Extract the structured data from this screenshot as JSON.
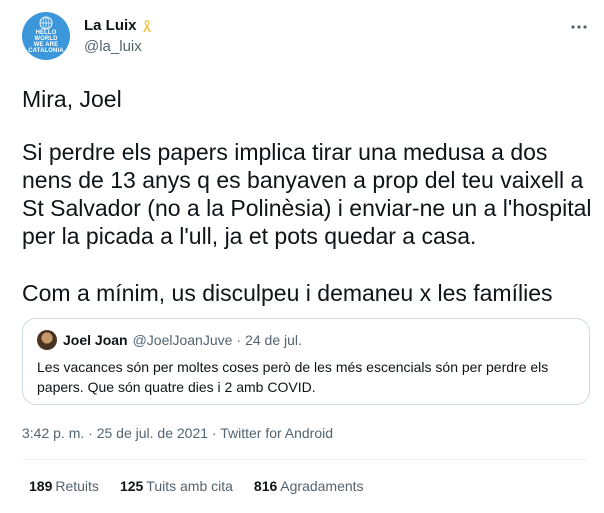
{
  "author": {
    "display_name": "La Luix",
    "handle": "@la_luix",
    "avatar_text": [
      "HELLO",
      "WORLD",
      "WE ARE",
      "CATALONIA"
    ]
  },
  "tweet": {
    "paragraphs": [
      "Mira, Joel",
      "Si perdre els papers implica tirar una medusa a dos nens de 13 anys q es banyaven a prop del teu vaixell a St Salvador (no a la Polinèsia) i enviar-ne un a l'hospital per la picada a l'ull, ja et pots quedar a casa.",
      "Com a mínim, us disculpeu i demaneu x les famílies"
    ]
  },
  "quoted_tweet": {
    "display_name": "Joel Joan",
    "handle": "@JoelJoanJuve",
    "separator": "·",
    "date": "24 de jul.",
    "text": "Les vacances són per moltes coses però de les més escencials són per perdre els papers. Que són quatre dies i 2 amb COVID."
  },
  "meta": {
    "timestamp": "3:42 p. m. · 25 de jul. de 2021 · Twitter for Android"
  },
  "stats": [
    {
      "count": "189",
      "label": "Retuits"
    },
    {
      "count": "125",
      "label": "Tuits amb cita"
    },
    {
      "count": "816",
      "label": "Agradaments"
    }
  ],
  "colors": {
    "ribbon": "#f2c94c",
    "avatar_bg": "#3b97d9",
    "secondary_text": "#536471",
    "border": "#cfd9de"
  },
  "icons": [
    "yellow-ribbon-icon",
    "more-options-icon"
  ]
}
